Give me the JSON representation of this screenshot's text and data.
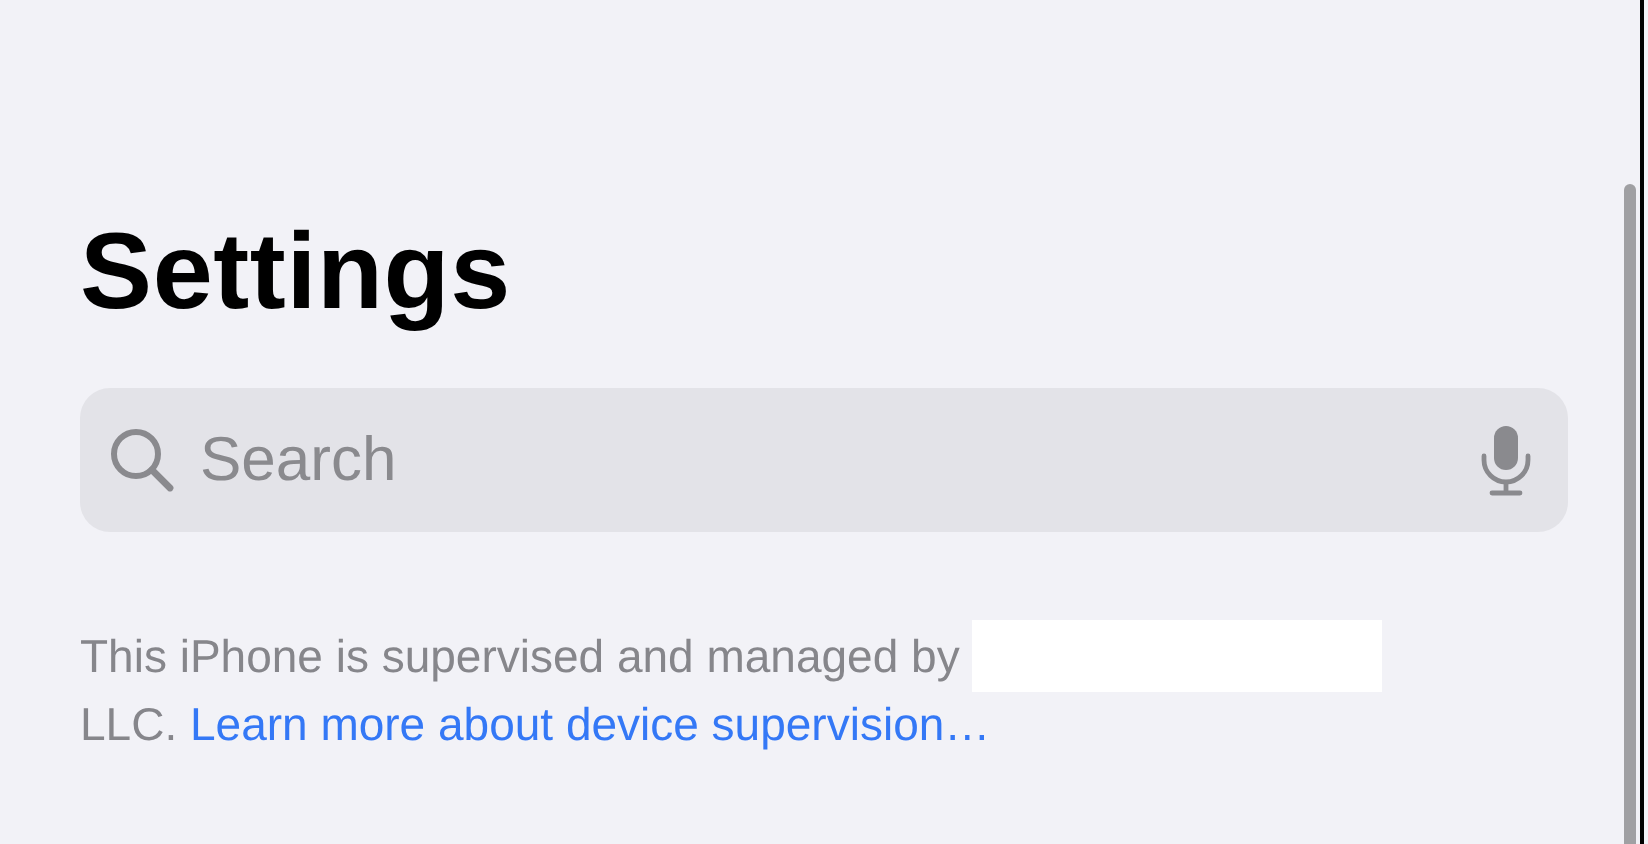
{
  "title": "Settings",
  "search": {
    "placeholder": "Search"
  },
  "supervision_note": {
    "text": "This iPhone is supervised and managed by",
    "redacted": true,
    "text_after": "LLC.",
    "link": "Learn more about device supervision…"
  }
}
